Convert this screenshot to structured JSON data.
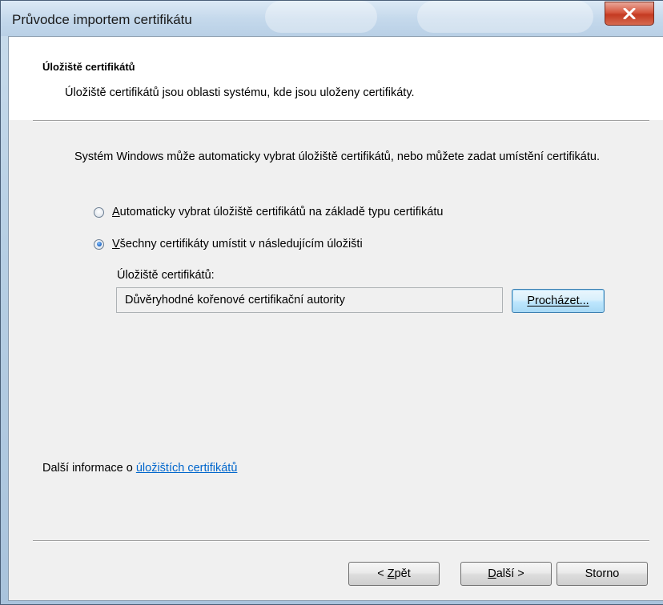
{
  "window": {
    "title": "Průvodce importem certifikátu",
    "close_label": "x"
  },
  "header": {
    "title": "Úložiště certifikátů",
    "subtitle": "Úložiště certifikátů jsou oblasti systému, kde jsou uloženy certifikáty."
  },
  "body": {
    "description": "Systém Windows může automaticky vybrat úložiště certifikátů, nebo můžete zadat umístění certifikátu.",
    "options": [
      {
        "mnemonic": "A",
        "label_rest": "utomaticky vybrat úložiště certifikátů na základě typu certifikátu",
        "checked": false
      },
      {
        "mnemonic": "V",
        "label_rest": "šechny certifikáty umístit v následujícím úložišti",
        "checked": true
      }
    ],
    "store_label": "Úložiště certifikátů:",
    "store_value": "Důvěryhodné kořenové certifikační autority",
    "browse_button": "Procházet..."
  },
  "info": {
    "prefix": "Další informace o ",
    "link": "úložištích certifikátů"
  },
  "footer": {
    "back": {
      "prefix": "< ",
      "mnemonic": "Z",
      "rest": "pět"
    },
    "next": {
      "mnemonic": "D",
      "rest": "alší >"
    },
    "cancel": "Storno"
  },
  "colors": {
    "link": "#0066cc",
    "focus_border": "#3c7fb1",
    "close_red": "#c43b22"
  }
}
